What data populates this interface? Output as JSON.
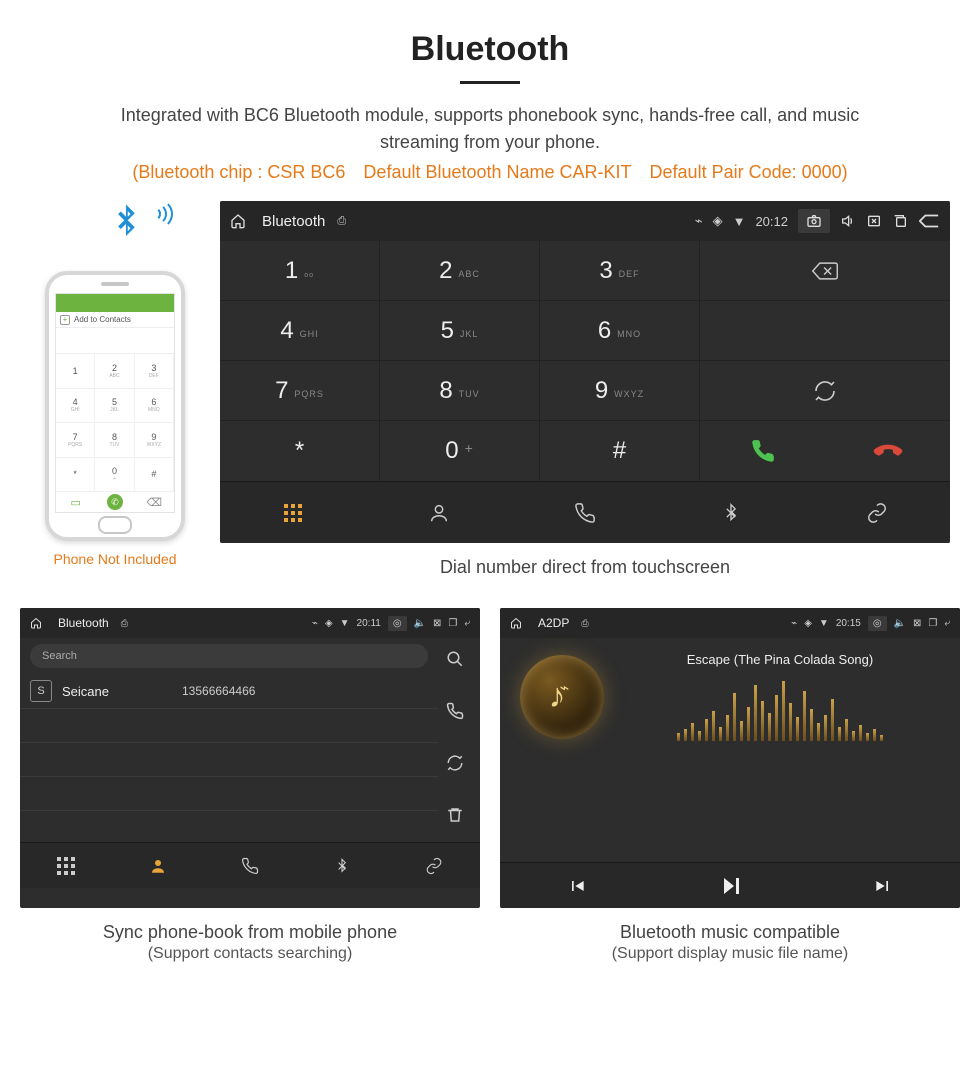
{
  "header": {
    "title": "Bluetooth",
    "description": "Integrated with BC6 Bluetooth module, supports phonebook sync, hands-free call, and music streaming from your phone.",
    "specs": "(Bluetooth chip : CSR BC6 Default Bluetooth Name CAR-KIT Default Pair Code: 0000)"
  },
  "phone": {
    "add_contacts": "Add to Contacts",
    "not_included": "Phone Not Included",
    "keys": [
      {
        "n": "1",
        "s": ""
      },
      {
        "n": "2",
        "s": "ABC"
      },
      {
        "n": "3",
        "s": "DEF"
      },
      {
        "n": "4",
        "s": "GHI"
      },
      {
        "n": "5",
        "s": "JKL"
      },
      {
        "n": "6",
        "s": "MNO"
      },
      {
        "n": "7",
        "s": "PQRS"
      },
      {
        "n": "8",
        "s": "TUV"
      },
      {
        "n": "9",
        "s": "WXYZ"
      },
      {
        "n": "*",
        "s": ""
      },
      {
        "n": "0",
        "s": "+"
      },
      {
        "n": "#",
        "s": ""
      }
    ]
  },
  "main_screen": {
    "title": "Bluetooth",
    "time": "20:12",
    "keypad": [
      {
        "n": "1",
        "s": "␣"
      },
      {
        "n": "2",
        "s": "ABC"
      },
      {
        "n": "3",
        "s": "DEF"
      },
      {
        "n": "4",
        "s": "GHI"
      },
      {
        "n": "5",
        "s": "JKL"
      },
      {
        "n": "6",
        "s": "MNO"
      },
      {
        "n": "7",
        "s": "PQRS"
      },
      {
        "n": "8",
        "s": "TUV"
      },
      {
        "n": "9",
        "s": "WXYZ"
      },
      {
        "n": "*",
        "s": ""
      },
      {
        "n": "0",
        "s": "+"
      },
      {
        "n": "#",
        "s": ""
      }
    ],
    "caption": "Dial number direct from touchscreen"
  },
  "phonebook_screen": {
    "title": "Bluetooth",
    "time": "20:11",
    "search_placeholder": "Search",
    "contact": {
      "initial": "S",
      "name": "Seicane",
      "number": "13566664466"
    },
    "caption_line1": "Sync phone-book from mobile phone",
    "caption_line2": "(Support contacts searching)"
  },
  "a2dp_screen": {
    "title": "A2DP",
    "time": "20:15",
    "track": "Escape (The Pina Colada Song)",
    "eq_bars": [
      8,
      12,
      18,
      10,
      22,
      30,
      14,
      26,
      48,
      20,
      34,
      56,
      40,
      28,
      46,
      60,
      38,
      24,
      50,
      32,
      18,
      26,
      42,
      14,
      22,
      10,
      16,
      8,
      12,
      6
    ],
    "caption_line1": "Bluetooth music compatible",
    "caption_line2": "(Support display music file name)"
  }
}
